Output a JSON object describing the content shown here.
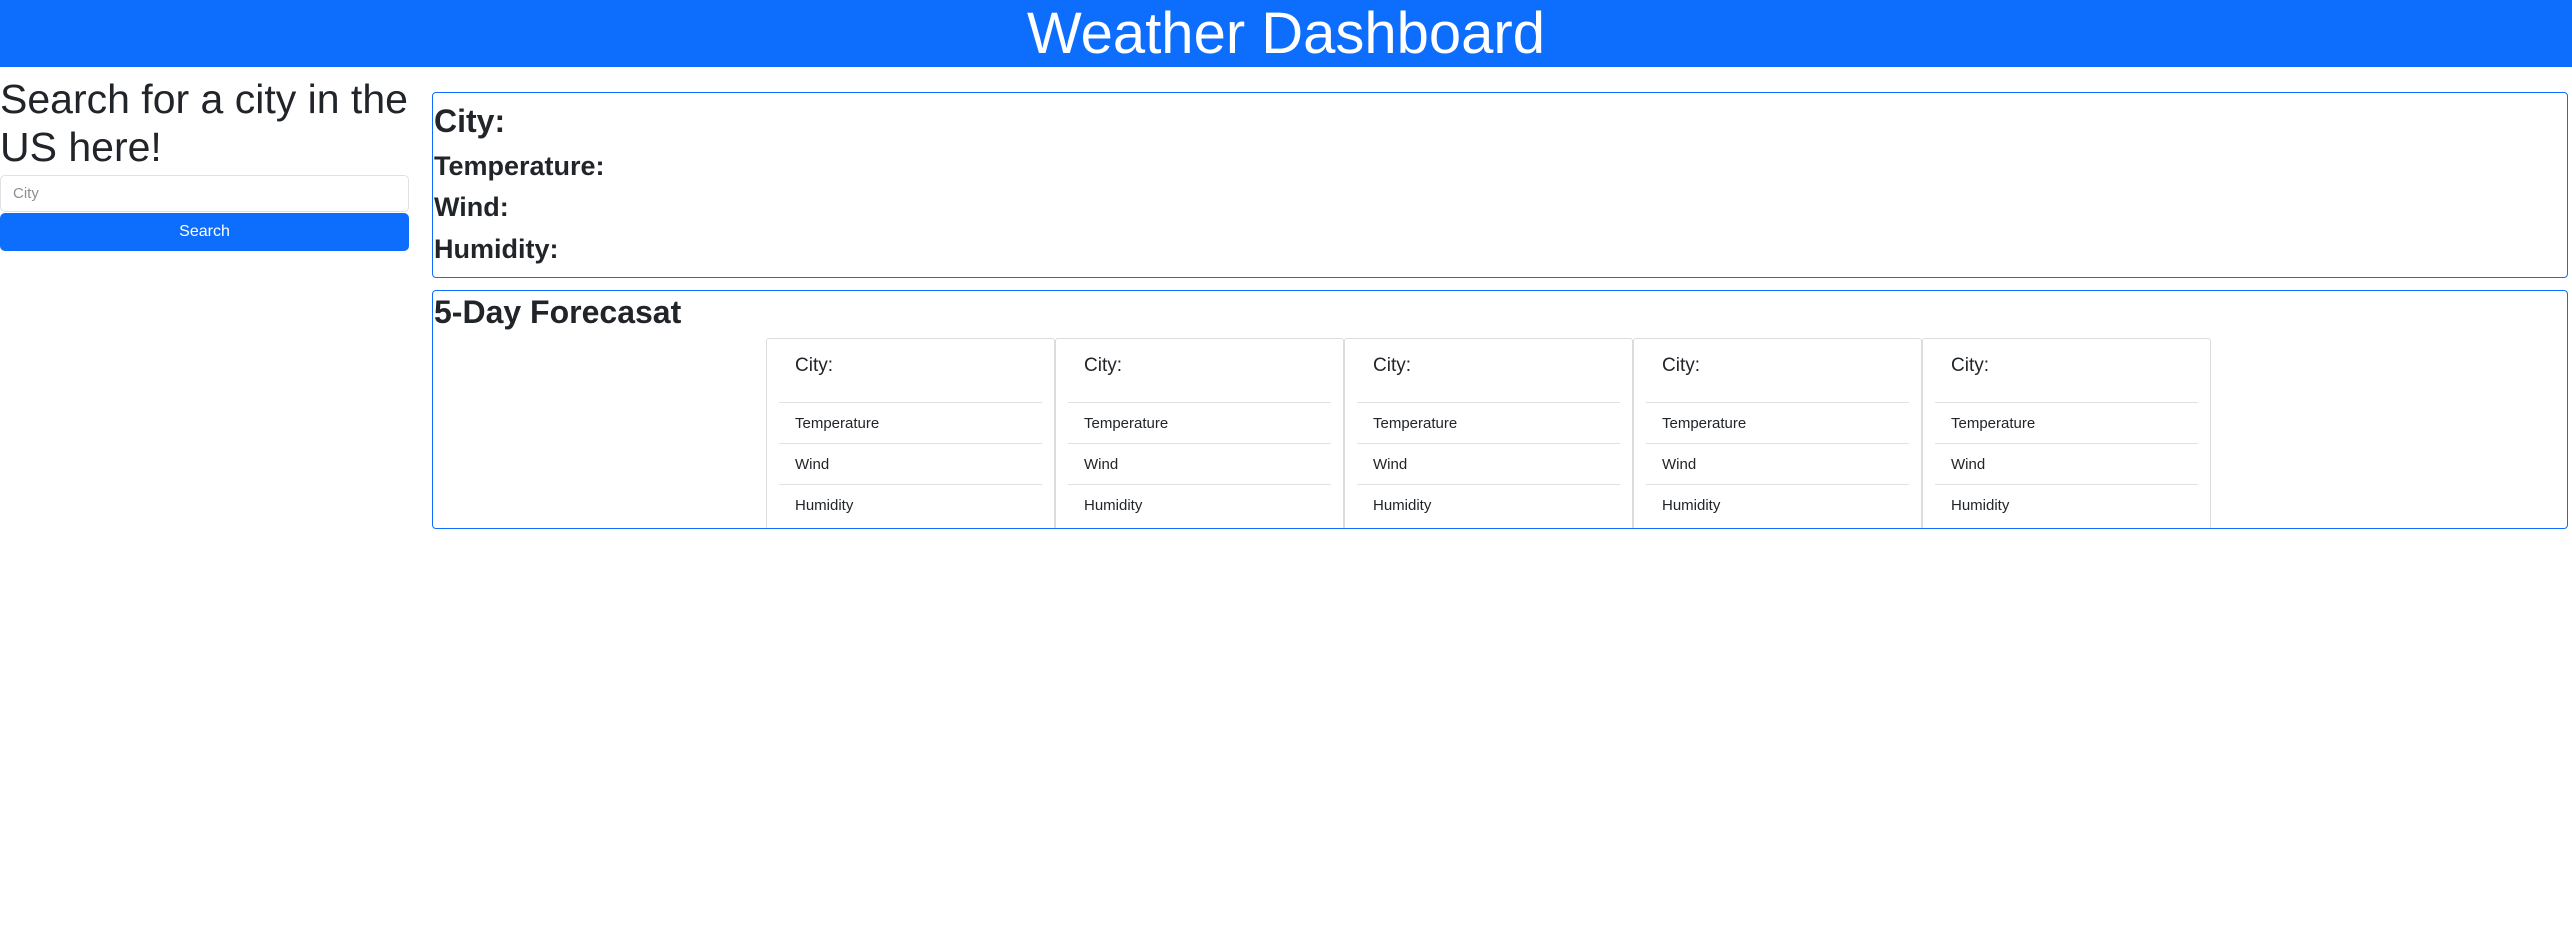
{
  "header": {
    "title": "Weather Dashboard"
  },
  "search": {
    "heading": "Search for a city in the US here!",
    "placeholder": "City",
    "value": "",
    "button_label": "Search"
  },
  "current": {
    "city_label": "City:",
    "temperature_label": "Temperature:",
    "wind_label": "Wind:",
    "humidity_label": "Humidity:"
  },
  "forecast": {
    "title": "5-Day Forecasat",
    "cards": [
      {
        "city": "City:",
        "temperature": "Temperature",
        "wind": "Wind",
        "humidity": "Humidity"
      },
      {
        "city": "City:",
        "temperature": "Temperature",
        "wind": "Wind",
        "humidity": "Humidity"
      },
      {
        "city": "City:",
        "temperature": "Temperature",
        "wind": "Wind",
        "humidity": "Humidity"
      },
      {
        "city": "City:",
        "temperature": "Temperature",
        "wind": "Wind",
        "humidity": "Humidity"
      },
      {
        "city": "City:",
        "temperature": "Temperature",
        "wind": "Wind",
        "humidity": "Humidity"
      }
    ]
  },
  "colors": {
    "primary": "#0d6efd",
    "text": "#212529",
    "border": "#dee2e6"
  }
}
